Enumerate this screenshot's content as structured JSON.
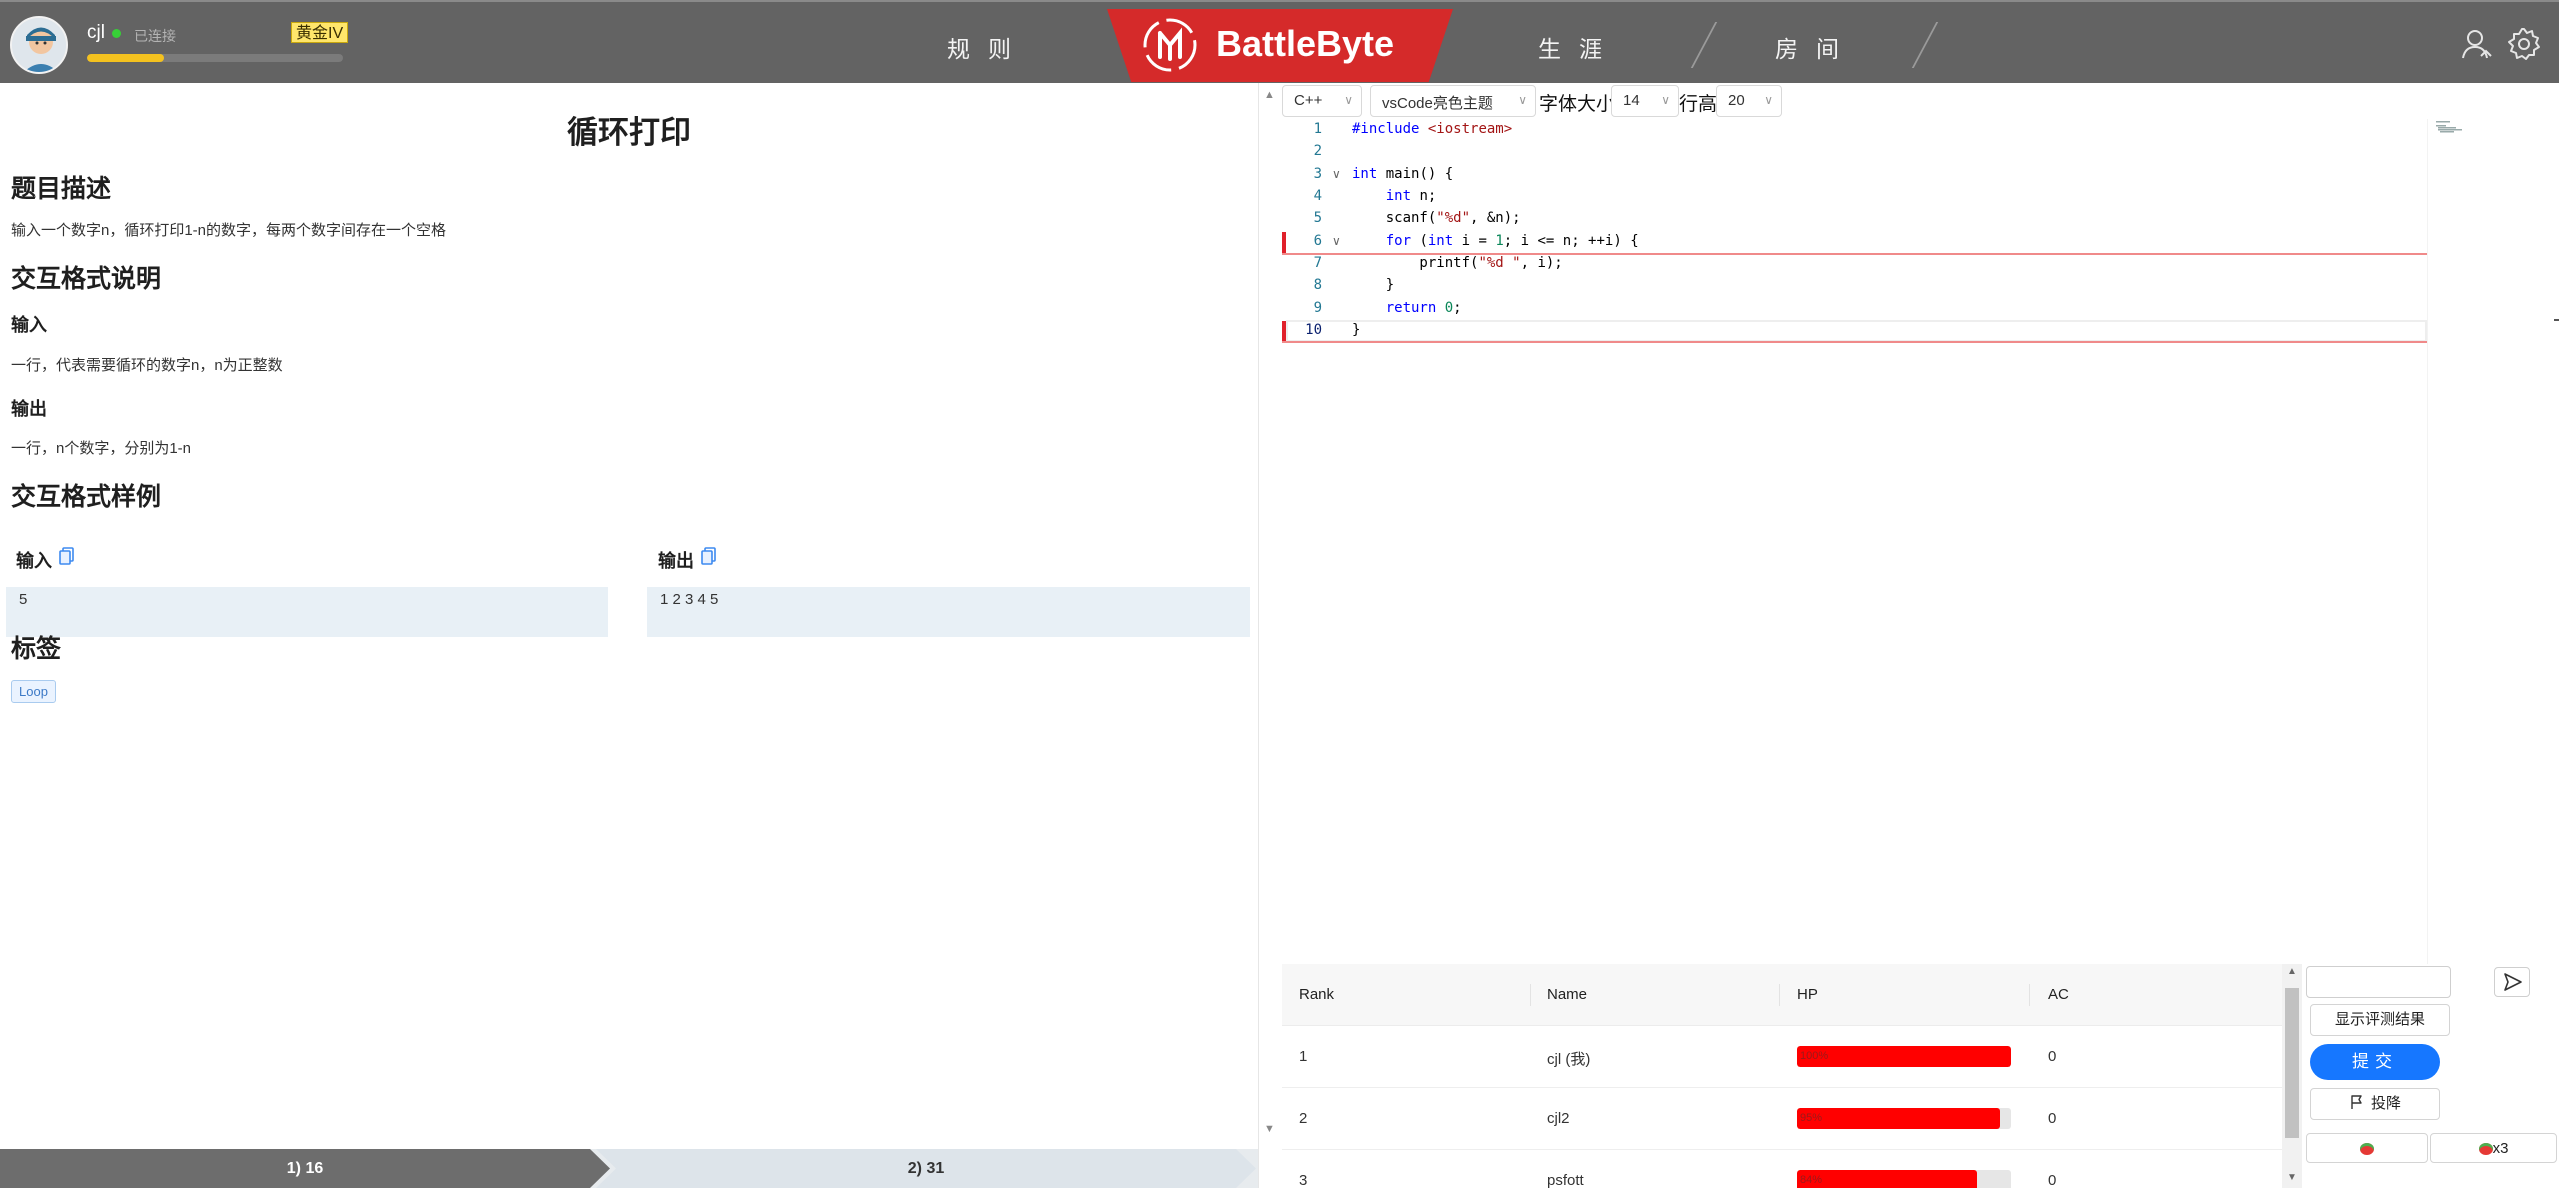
{
  "user": {
    "name": "cjl",
    "status": "已连接",
    "rank_badge": "黄金IV",
    "exp_progress": 0.3
  },
  "nav": {
    "rules": "规则",
    "career": "生涯",
    "room": "房间",
    "brand": "BattleByte"
  },
  "problem": {
    "title": "循环打印",
    "desc_heading": "题目描述",
    "desc_text": "输入一个数字n，循环打印1-n的数字，每两个数字间存在一个空格",
    "io_heading": "交互格式说明",
    "input_heading": "输入",
    "input_text": "一行，代表需要循环的数字n，n为正整数",
    "output_heading": "输出",
    "output_text": "一行，n个数字，分别为1-n",
    "sample_heading": "交互格式样例",
    "sample_input_label": "输入",
    "sample_output_label": "输出",
    "sample_input": "5",
    "sample_output": "1 2 3 4 5",
    "tags_heading": "标签",
    "tags": [
      "Loop"
    ]
  },
  "tabs": [
    "1) 16",
    "2) 31"
  ],
  "editor": {
    "language": "C++",
    "theme": "vsCode亮色主题",
    "font_size_label": "字体大小",
    "font_size": "14",
    "line_height_label": "行高",
    "line_height": "20",
    "line_numbers": [
      "1",
      "2",
      "3",
      "4",
      "5",
      "6",
      "7",
      "8",
      "9",
      "10"
    ]
  },
  "ranking": {
    "headers": [
      "Rank",
      "Name",
      "HP",
      "AC"
    ],
    "rows": [
      {
        "rank": "1",
        "name": "cjl (我)",
        "hp": 1.0,
        "hp_label": "100%",
        "ac": "0"
      },
      {
        "rank": "2",
        "name": "cjl2",
        "hp": 0.95,
        "hp_label": "95%",
        "ac": "0"
      },
      {
        "rank": "3",
        "name": "psfott",
        "hp": 0.84,
        "hp_label": "84%",
        "ac": "0"
      }
    ]
  },
  "actions": {
    "show_results": "显示评测结果",
    "submit": "提交",
    "surrender": "投降",
    "tomato_count": "x3"
  },
  "colors": {
    "topbar": "#636363",
    "brand_red": "#d52a2a",
    "submit_blue": "#1677ff",
    "hp_red": "#ff0000",
    "gold": "#ffe66b"
  }
}
